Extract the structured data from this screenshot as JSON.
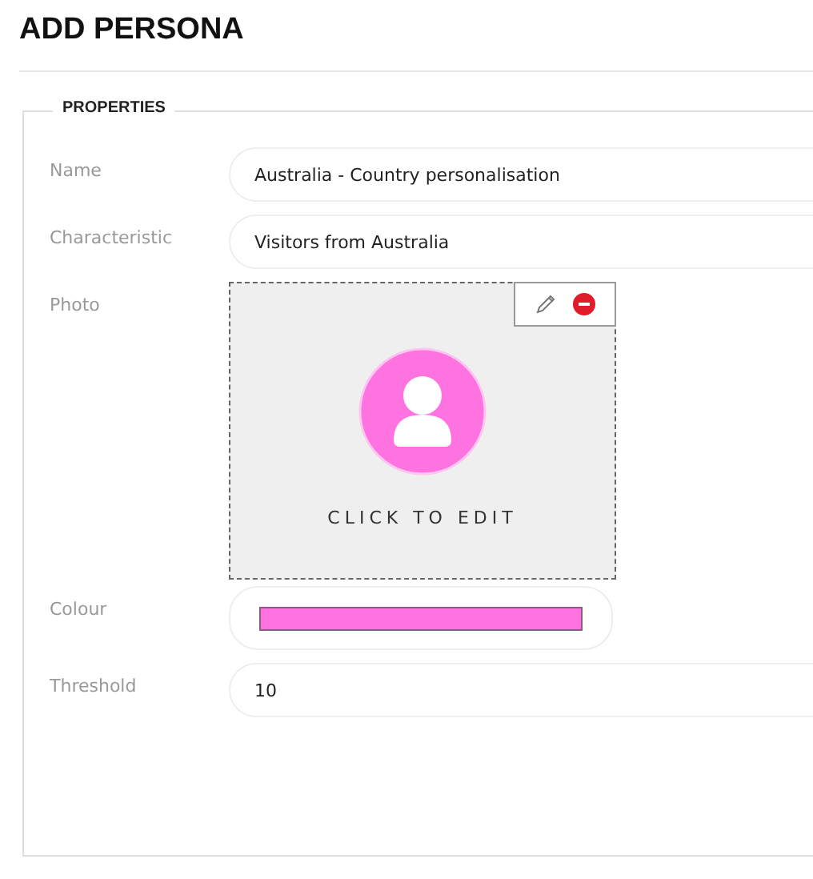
{
  "title": "ADD PERSONA",
  "section": {
    "legend": "PROPERTIES"
  },
  "fields": [
    {
      "kind": "text",
      "label": "Name",
      "value": "Australia - Country personalisation"
    },
    {
      "kind": "text",
      "label": "Characteristic",
      "value": "Visitors from Australia"
    },
    {
      "kind": "photo",
      "label": "Photo",
      "caption": "CLICK TO EDIT"
    },
    {
      "kind": "colour",
      "label": "Colour",
      "color": "#ff73e1"
    },
    {
      "kind": "text",
      "label": "Threshold",
      "value": "10"
    }
  ]
}
